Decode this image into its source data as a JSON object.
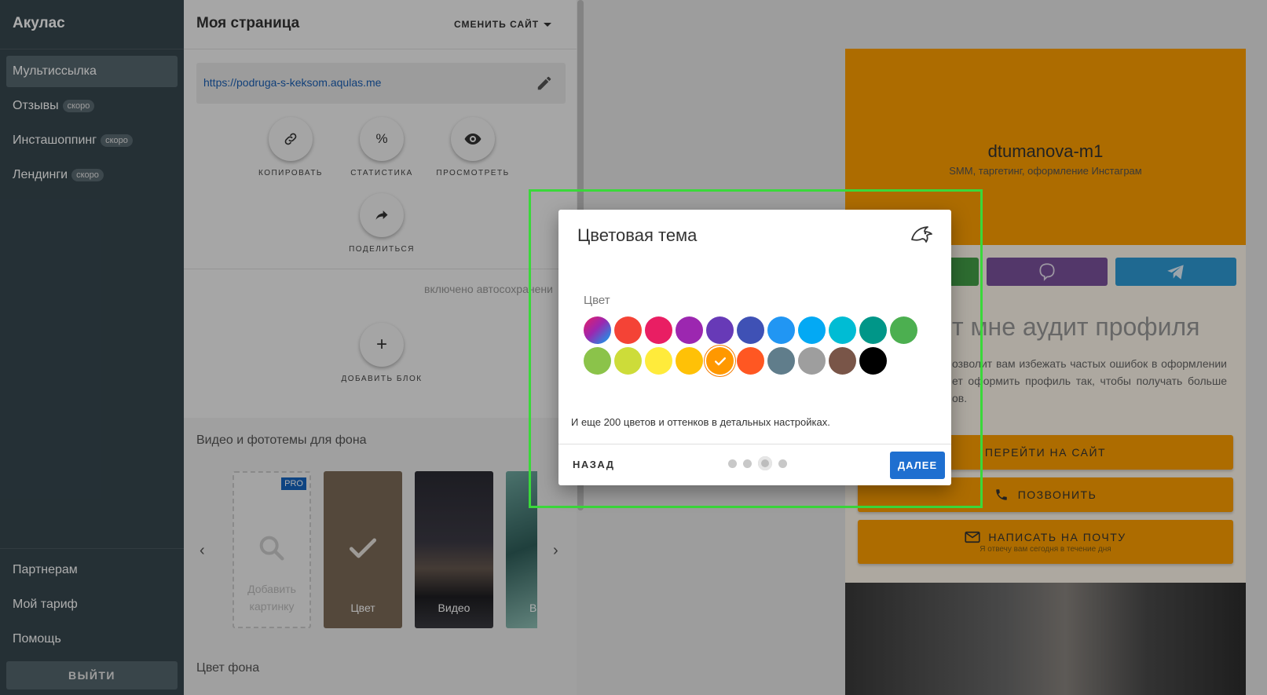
{
  "sidebar": {
    "brand": "Акулас",
    "items": [
      {
        "label": "Мультиссылка",
        "badge": "",
        "active": true
      },
      {
        "label": "Отзывы",
        "badge": "скоро"
      },
      {
        "label": "Инсташоппинг",
        "badge": "скоро"
      },
      {
        "label": "Лендинги",
        "badge": "скоро"
      }
    ],
    "bottom_items": [
      {
        "label": "Партнерам"
      },
      {
        "label": "Мой тариф"
      },
      {
        "label": "Помощь"
      }
    ],
    "logout_label": "ВЫЙТИ"
  },
  "panel": {
    "title": "Моя страница",
    "change_site_label": "СМЕНИТЬ САЙТ",
    "url": "https://podruga-s-keksom.aqulas.me",
    "actions": [
      {
        "label": "КОПИРОВАТЬ",
        "icon": "link-icon"
      },
      {
        "label": "СТАТИСТИКА",
        "icon": "percent-icon"
      },
      {
        "label": "ПРОСМОТРЕТЬ",
        "icon": "eye-icon"
      },
      {
        "label": "ПОДЕЛИТЬСЯ",
        "icon": "share-icon"
      }
    ],
    "autosave_text": "включено автосохранени",
    "add_block_label": "ДОБАВИТЬ БЛОК",
    "bg_section_title": "Видео и фототемы для фона",
    "bg_tiles": [
      {
        "label": "Добавить картинку",
        "badge": "PRO"
      },
      {
        "label": "Цвет"
      },
      {
        "label": "Видео"
      },
      {
        "label": "Ви"
      }
    ],
    "bg_color_title": "Цвет фона"
  },
  "preview": {
    "name": "dtumanova-m1",
    "description": "SMM, таргетинг, оформление Инстаграм",
    "heading": "т мне аудит профиля",
    "text": "озволит вам избежать частых ошибок в оформлении ет оформить профиль так, чтобы получать больше ов.",
    "buttons": [
      {
        "label": "ПЕРЕЙТИ НА САЙТ"
      },
      {
        "label": "ПОЗВОНИТЬ"
      },
      {
        "label": "НАПИСАТЬ НА ПОЧТУ",
        "sub": "Я отвечу вам сегодня в течение дня"
      }
    ],
    "header_color": "#ffa000"
  },
  "modal": {
    "title": "Цветовая тема",
    "color_label": "Цвет",
    "swatches_row1": [
      "gradient",
      "#f44336",
      "#e91e63",
      "#9c27b0",
      "#673ab7",
      "#3f51b5",
      "#2196f3",
      "#03a9f4",
      "#00bcd4",
      "#009688",
      "#4caf50"
    ],
    "swatches_row2": [
      "#8bc34a",
      "#cddc39",
      "#ffeb3b",
      "#ffc107",
      "#ff9800",
      "#ff5722",
      "#607d8b",
      "#9e9e9e",
      "#795548",
      "#000000"
    ],
    "selected_swatch": "#ff9800",
    "note": "И еще 200 цветов и оттенков в детальных настройках.",
    "back_label": "НАЗАД",
    "next_label": "ДАЛЕЕ",
    "step_total": 4,
    "step_current": 3
  }
}
